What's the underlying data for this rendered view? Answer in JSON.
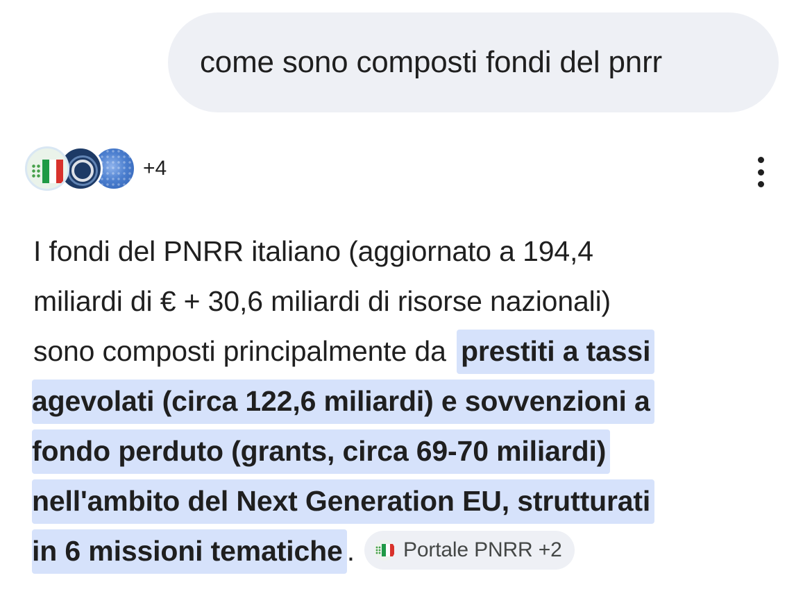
{
  "user_message": "come sono composti fondi del pnrr",
  "sources": {
    "more_count": "+4",
    "avatar_icons": [
      "italia-flag-icon",
      "dark-ring-logo-icon",
      "blue-globe-icon"
    ]
  },
  "menu_icon": "more-vert-icon",
  "answer": {
    "line1": "I fondi del PNRR italiano (aggiornato a 194,4",
    "line2": "miliardi di € + 30,6 miliardi di risorse nazionali)",
    "line3_plain": "sono composti principalmente da ",
    "line3_highlight": "prestiti a tassi",
    "line4_highlight": "agevolati (circa 122,6 miliardi) e sovvenzioni a",
    "line5_highlight": "fondo perduto (grants, circa 69-70 miliardi)",
    "line6_highlight": "nell'ambito del Next Generation EU, strutturati",
    "line7_highlight": "in 6 missioni tematiche",
    "line7_period": "."
  },
  "citation_chip": {
    "label": "Portale PNRR +2",
    "icon": "italia-flag-icon"
  },
  "colors": {
    "highlight": "#d6e2fb",
    "bubble": "#eef0f5",
    "flag_green": "#1f9a45",
    "flag_red": "#d8322c"
  }
}
